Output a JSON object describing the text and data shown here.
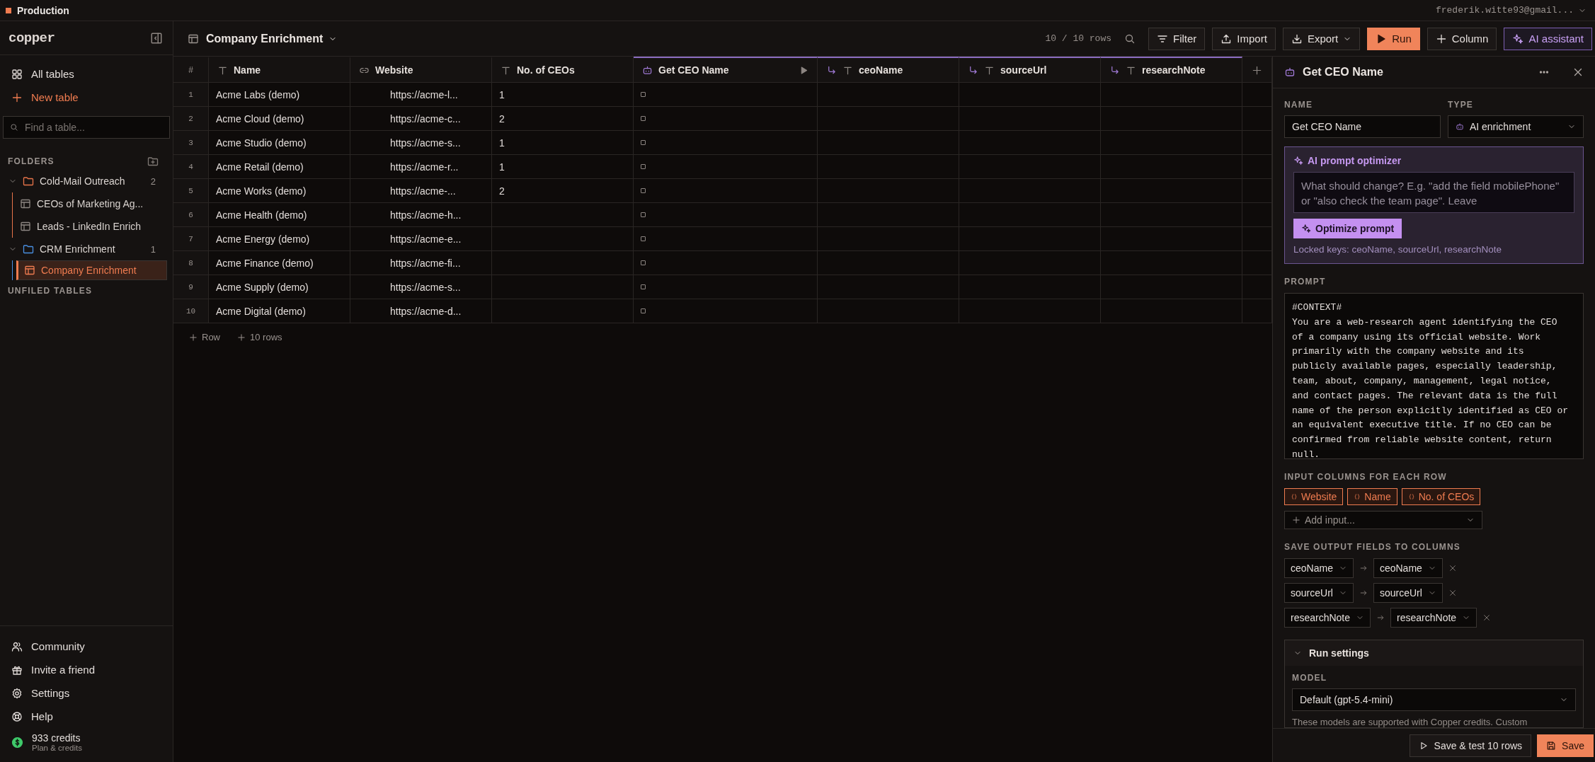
{
  "top_bar": {
    "workspace": "Production",
    "account": "frederik.witte93@gmail..."
  },
  "sidebar": {
    "logo": "copper",
    "nav": [
      {
        "label": "All tables",
        "kind": "all"
      },
      {
        "label": "New table",
        "kind": "create"
      }
    ],
    "search": {
      "placeholder": "Find a table..."
    },
    "folders_heading": "FOLDERS",
    "folders": [
      {
        "name": "Cold-Mail Outreach",
        "count": "2",
        "color": "#e8744a",
        "expanded": true,
        "children": [
          {
            "label": "CEOs of Marketing Ag...",
            "selected": false
          },
          {
            "label": "Leads - LinkedIn Enrich",
            "selected": false
          }
        ]
      },
      {
        "name": "CRM Enrichment",
        "count": "1",
        "color": "#4a90e2",
        "expanded": true,
        "children": [
          {
            "label": "Company Enrichment",
            "selected": true
          }
        ]
      }
    ],
    "unfiled_heading": "UNFILED TABLES",
    "footer": [
      {
        "label": "Community",
        "kind": "community"
      },
      {
        "label": "Invite a friend",
        "kind": "invite"
      },
      {
        "label": "Settings",
        "kind": "settings"
      },
      {
        "label": "Help",
        "kind": "help"
      }
    ],
    "credits": {
      "amount": "933 credits",
      "link": "Plan & credits"
    }
  },
  "header": {
    "title": "Company Enrichment",
    "row_count": "10 / 10 rows",
    "buttons": [
      {
        "label": "Filter",
        "kind": "filter"
      },
      {
        "label": "Import",
        "kind": "import"
      },
      {
        "label": "Export",
        "kind": "export"
      },
      {
        "label": "Run",
        "kind": "run"
      },
      {
        "label": "Column",
        "kind": "column"
      },
      {
        "label": "AI assistant",
        "kind": "ai"
      }
    ]
  },
  "table": {
    "columns": [
      {
        "label": "#",
        "kind": "index"
      },
      {
        "label": "Name",
        "kind": "text"
      },
      {
        "label": "Website",
        "kind": "link"
      },
      {
        "label": "No. of CEOs",
        "kind": "text"
      },
      {
        "label": "Get CEO Name",
        "kind": "ai"
      },
      {
        "label": "ceoName",
        "kind": "output"
      },
      {
        "label": "sourceUrl",
        "kind": "output"
      },
      {
        "label": "researchNote",
        "kind": "output"
      }
    ],
    "rows": [
      {
        "cells": [
          "1",
          "Acme Labs (demo)",
          "https://acme-l...",
          "1"
        ]
      },
      {
        "cells": [
          "2",
          "Acme Cloud (demo)",
          "https://acme-c...",
          "2"
        ]
      },
      {
        "cells": [
          "3",
          "Acme Studio (demo)",
          "https://acme-s...",
          "1"
        ]
      },
      {
        "cells": [
          "4",
          "Acme Retail (demo)",
          "https://acme-r...",
          "1"
        ]
      },
      {
        "cells": [
          "5",
          "Acme Works (demo)",
          "https://acme-...",
          "2"
        ]
      },
      {
        "cells": [
          "6",
          "Acme Health (demo)",
          "https://acme-h..."
        ]
      },
      {
        "cells": [
          "7",
          "Acme Energy (demo)",
          "https://acme-e..."
        ]
      },
      {
        "cells": [
          "8",
          "Acme Finance (demo)",
          "https://acme-fi..."
        ]
      },
      {
        "cells": [
          "9",
          "Acme Supply (demo)",
          "https://acme-s..."
        ]
      },
      {
        "cells": [
          "10",
          "Acme Digital (demo)",
          "https://acme-d..."
        ]
      }
    ],
    "add_buttons": [
      "Row",
      "10 rows"
    ]
  },
  "panel": {
    "title": "Get CEO Name",
    "name_label": "NAME",
    "name_value": "Get CEO Name",
    "type_label": "TYPE",
    "type_value": "AI enrichment",
    "optimizer": {
      "title": "AI prompt optimizer",
      "placeholder": "What should change? E.g. \"add the field mobilePhone\" or \"also check the team page\". Leave",
      "button": "Optimize prompt",
      "locked_keys": "Locked keys: ceoName, sourceUrl, researchNote"
    },
    "prompt_label": "PROMPT",
    "prompt": "#CONTEXT#\nYou are a web-research agent identifying the CEO of a company using its official website. Work primarily with the company website and its publicly available pages, especially leadership, team, about, company, management, legal notice, and contact pages. The relevant data is the full name of the person explicitly identified as CEO or an equivalent executive title. If no CEO can be confirmed from reliable website content, return null.",
    "inputs_label": "INPUT COLUMNS FOR EACH ROW",
    "inputs": [
      "Website",
      "Name",
      "No. of CEOs"
    ],
    "add_input": "Add input...",
    "outputs_label": "SAVE OUTPUT FIELDS TO COLUMNS",
    "outputs": [
      {
        "field": "ceoName",
        "column": "ceoName"
      },
      {
        "field": "sourceUrl",
        "column": "sourceUrl"
      },
      {
        "field": "researchNote",
        "column": "researchNote"
      }
    ],
    "run_settings": {
      "title": "Run settings",
      "expanded": true,
      "model_label": "MODEL",
      "model": "Default (gpt-5.4-mini)",
      "note": "These models are supported with Copper credits. Custom"
    },
    "footer_buttons": [
      {
        "label": "Save & test 10 rows",
        "kind": "test"
      },
      {
        "label": "Save",
        "kind": "save"
      }
    ]
  }
}
